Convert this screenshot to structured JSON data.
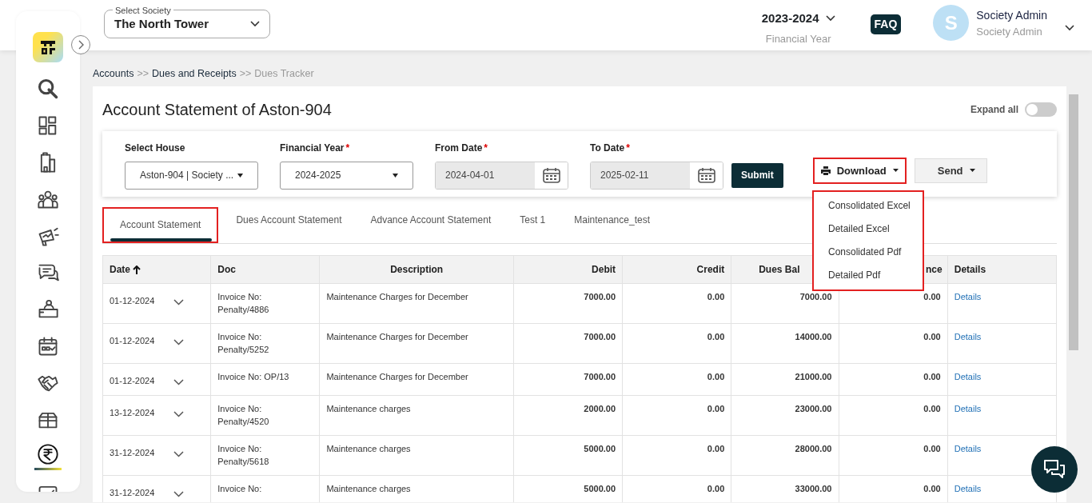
{
  "society_select": {
    "label": "Select Society",
    "value": "The North Tower"
  },
  "financial_year": {
    "value": "2023-2024",
    "label": "Financial Year"
  },
  "faq": "FAQ",
  "user": {
    "initial": "S",
    "name": "Society Admin",
    "role": "Society Admin"
  },
  "sidebar": {
    "items": [
      {
        "selected": false
      },
      {
        "selected": false
      },
      {
        "selected": false
      },
      {
        "selected": false
      },
      {
        "selected": false
      },
      {
        "selected": false
      },
      {
        "selected": false
      },
      {
        "selected": false
      },
      {
        "selected": false
      },
      {
        "selected": false
      },
      {
        "selected": true
      },
      {
        "selected": false
      }
    ]
  },
  "breadcrumb": [
    {
      "label": "Accounts",
      "current": false
    },
    {
      "label": ">>",
      "kind": "sep"
    },
    {
      "label": "Dues and Receipts",
      "current": false
    },
    {
      "label": ">>",
      "kind": "sep"
    },
    {
      "label": "Dues Tracker",
      "current": true
    }
  ],
  "page_title": "Account Statement of Aston-904",
  "expand_all": {
    "label": "Expand all",
    "on": false
  },
  "filters": [
    {
      "kind": "select",
      "label": "Select House",
      "value": "Aston-904 | Society ..."
    },
    {
      "kind": "select",
      "label": "Financial Year",
      "required_mark": "*",
      "value": "2024-2025"
    },
    {
      "kind": "date",
      "label": "From Date",
      "required_mark": "*",
      "value": "2024-04-01"
    },
    {
      "kind": "date",
      "label": "To Date",
      "required_mark": "*",
      "value": "2025-02-11"
    }
  ],
  "submit": "Submit",
  "download": {
    "label": "Download",
    "highlighted": true,
    "menu": {
      "highlighted": true,
      "items": [
        "Consolidated Excel",
        "Detailed Excel",
        "Consolidated Pdf",
        "Detailed Pdf"
      ]
    }
  },
  "send": "Send",
  "tabs": [
    {
      "label": "Account Statement",
      "selected": true,
      "highlighted": true
    },
    {
      "label": "Dues Account Statement",
      "selected": false,
      "highlighted": false
    },
    {
      "label": "Advance Account Statement",
      "selected": false,
      "highlighted": false
    },
    {
      "label": "Test 1",
      "selected": false,
      "highlighted": false
    },
    {
      "label": "Maintenance_test",
      "selected": false,
      "highlighted": false
    }
  ],
  "table": {
    "columns": [
      {
        "label": "Date",
        "sorted": true
      },
      {
        "label": "Doc",
        "sorted": false
      },
      {
        "label": "Description",
        "sorted": false
      },
      {
        "label": "Debit",
        "sorted": false
      },
      {
        "label": "Credit",
        "sorted": false
      },
      {
        "label": "Dues Bal",
        "sorted": false
      },
      {
        "label": "nce",
        "sorted": false
      },
      {
        "label": "Details",
        "sorted": false
      }
    ],
    "rows": [
      {
        "date": "01-12-2024",
        "expanded": false,
        "doc": "Invoice No: Penalty/4886",
        "description": "Maintenance Charges for December",
        "debit": "7000.00",
        "credit": "0.00",
        "dues_balance": "7000.00",
        "column_7": "0.00",
        "details": "Details"
      },
      {
        "date": "01-12-2024",
        "expanded": false,
        "doc": "Invoice No: Penalty/5252",
        "description": "Maintenance Charges for December",
        "debit": "7000.00",
        "credit": "0.00",
        "dues_balance": "14000.00",
        "column_7": "0.00",
        "details": "Details"
      },
      {
        "date": "01-12-2024",
        "expanded": false,
        "doc": "Invoice No: OP/13",
        "description": "Maintenance Charges for December",
        "debit": "7000.00",
        "credit": "0.00",
        "dues_balance": "21000.00",
        "column_7": "0.00",
        "details": "Details"
      },
      {
        "date": "13-12-2024",
        "expanded": false,
        "doc": "Invoice No: Penalty/4520",
        "description": "Maintenance charges",
        "debit": "2000.00",
        "credit": "0.00",
        "dues_balance": "23000.00",
        "column_7": "0.00",
        "details": "Details"
      },
      {
        "date": "31-12-2024",
        "expanded": false,
        "doc": "Invoice No: Penalty/5618",
        "description": "Maintenance charges",
        "debit": "5000.00",
        "credit": "0.00",
        "dues_balance": "28000.00",
        "column_7": "0.00",
        "details": "Details"
      },
      {
        "date": "31-12-2024",
        "expanded": false,
        "doc": "Invoice No:",
        "description": "Maintenance charges",
        "debit": "5000.00",
        "credit": "0.00",
        "dues_balance": "33000.00",
        "column_7": "0.00",
        "details": "Details"
      }
    ]
  }
}
